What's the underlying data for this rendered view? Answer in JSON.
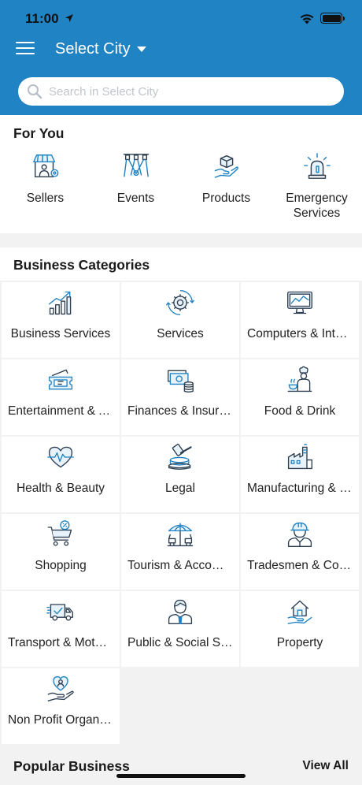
{
  "status_bar": {
    "time": "11:00"
  },
  "header": {
    "city_label": "Select City"
  },
  "search": {
    "placeholder": "Search in Select City"
  },
  "for_you": {
    "title": "For You",
    "items": [
      {
        "label": "Sellers",
        "icon": "store-icon"
      },
      {
        "label": "Events",
        "icon": "stage-lights-icon"
      },
      {
        "label": "Products",
        "icon": "hand-box-icon"
      },
      {
        "label": "Emergency Services",
        "icon": "siren-icon"
      }
    ]
  },
  "business_categories": {
    "title": "Business Categories",
    "items": [
      {
        "label": "Business Services",
        "icon": "growth-chart-icon"
      },
      {
        "label": "Services",
        "icon": "gear-cycle-icon"
      },
      {
        "label": "Computers & Internet",
        "icon": "monitor-icon"
      },
      {
        "label": "Entertainment & Arts",
        "icon": "ticket-icon"
      },
      {
        "label": "Finances & Insurance",
        "icon": "money-icon"
      },
      {
        "label": "Food & Drink",
        "icon": "chef-icon"
      },
      {
        "label": "Health & Beauty",
        "icon": "heart-pulse-icon"
      },
      {
        "label": "Legal",
        "icon": "gavel-icon"
      },
      {
        "label": "Manufacturing & Industry",
        "icon": "factory-icon"
      },
      {
        "label": "Shopping",
        "icon": "cart-icon"
      },
      {
        "label": "Tourism & Accommodation",
        "icon": "beach-umbrella-icon"
      },
      {
        "label": "Tradesmen & Construction",
        "icon": "worker-icon"
      },
      {
        "label": "Transport & Motoring",
        "icon": "truck-icon"
      },
      {
        "label": "Public & Social Services",
        "icon": "official-icon"
      },
      {
        "label": "Property",
        "icon": "house-hand-icon"
      },
      {
        "label": "Non Profit Organisations",
        "icon": "charity-icon"
      }
    ]
  },
  "popular": {
    "title": "Popular Business",
    "view_all_label": "View All"
  },
  "colors": {
    "header_blue": "#1f83c4",
    "icon_blue": "#1f83c4",
    "icon_dark": "#2c3e50"
  }
}
